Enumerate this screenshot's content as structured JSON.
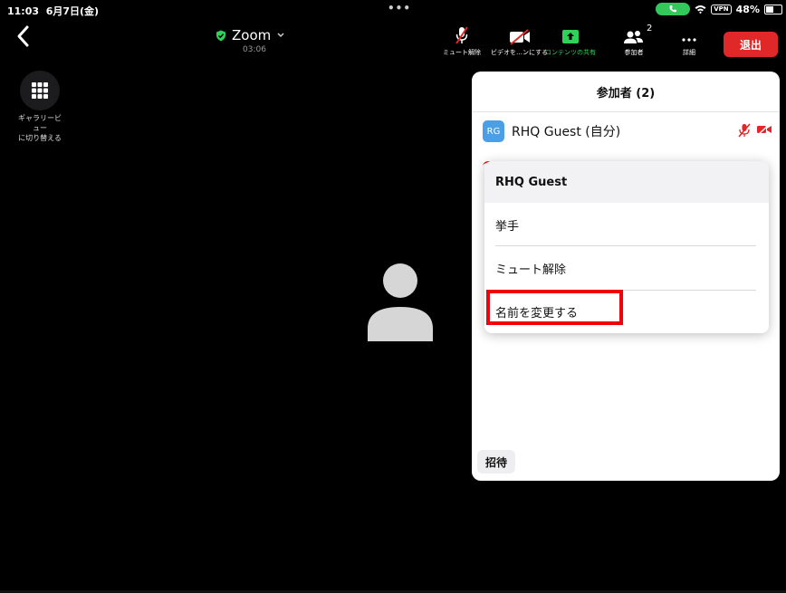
{
  "status_bar": {
    "time": "11:03",
    "date": "6月7日(金)",
    "vpn": "VPN",
    "battery": "48%"
  },
  "toolbar": {
    "meeting_title": "Zoom",
    "timer": "03:06",
    "unmute_label": "ミュート解除",
    "video_label": "ビデオを…ンにする",
    "share_label": "コンテンツの共有",
    "participants_label": "参加者",
    "participants_count": "2",
    "more_label": "詳細",
    "leave_label": "退出"
  },
  "gallery": {
    "label_line1": "ギャラリービ",
    "label_line2": "ュー",
    "label_line3": "に切り替える"
  },
  "panel": {
    "title": "参加者 (2)",
    "participant": {
      "initials": "RG",
      "name": "RHQ Guest (自分)"
    },
    "invite_label": "招待"
  },
  "popover": {
    "title": "RHQ Guest",
    "items": [
      {
        "label": "挙手"
      },
      {
        "label": "ミュート解除"
      },
      {
        "label": "名前を変更する"
      }
    ]
  },
  "colors": {
    "leave": "#e02828",
    "share_green": "#30d158",
    "highlight": "#f0000a",
    "avatar_blue": "#4a9fe6"
  }
}
